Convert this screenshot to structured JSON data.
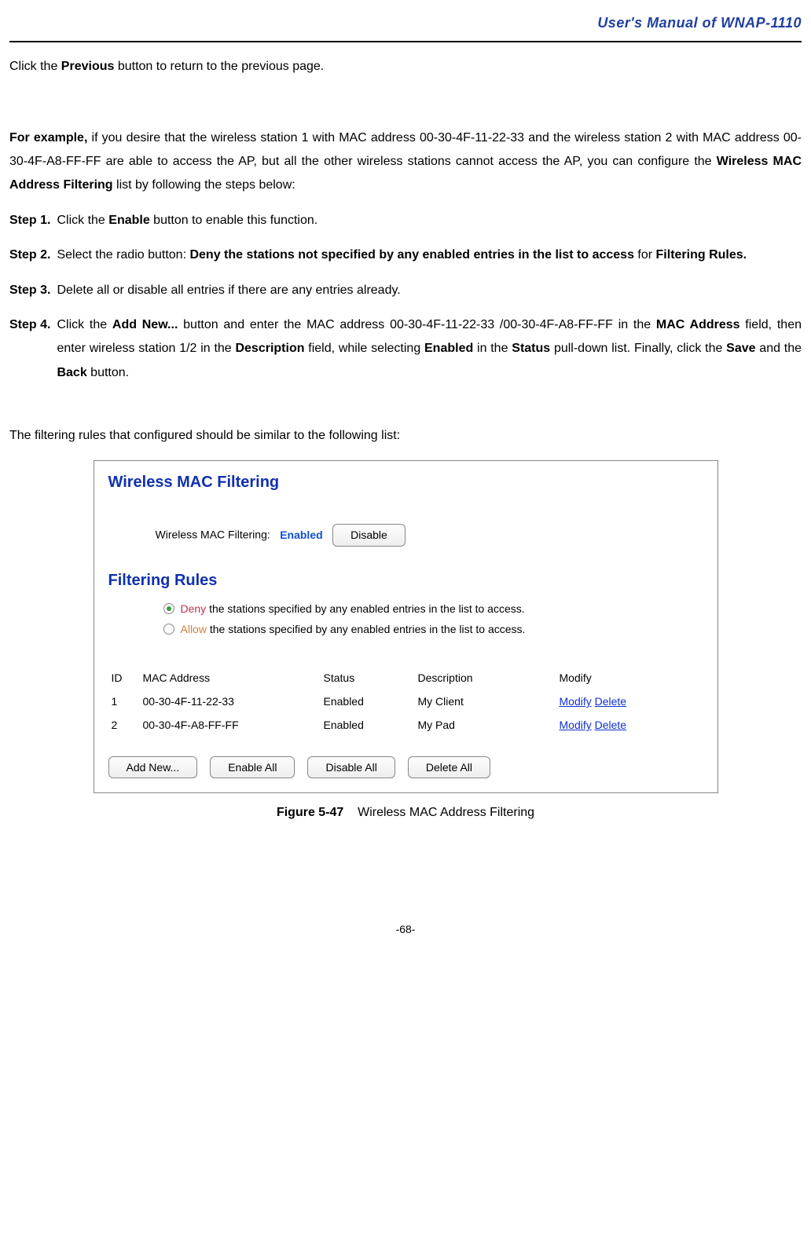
{
  "header": {
    "title": "User's  Manual  of  WNAP-1110"
  },
  "topline": {
    "prefix": "Click the ",
    "bold": "Previous",
    "suffix": " button to return to the previous page."
  },
  "intro": {
    "lead_bold": "For example,",
    "lead_rest": " if you desire that the wireless station 1 with MAC address 00-30-4F-11-22-33 and the wireless station 2 with MAC address 00-30-4F-A8-FF-FF are able to access the AP, but all the other wireless stations cannot access the AP, you can configure the ",
    "mid_bold": "Wireless MAC Address Filtering",
    "lead_tail": " list by following the steps below:"
  },
  "steps": {
    "s1": {
      "label": "Step 1.",
      "a": "Click the ",
      "b1": "Enable",
      "c": " button to enable this function."
    },
    "s2": {
      "label": "Step 2.",
      "a": "Select the radio button: ",
      "b1": "Deny the stations not specified by any enabled entries in the list to access",
      "c": " for ",
      "b2": "Filtering Rules."
    },
    "s3": {
      "label": "Step 3.",
      "a": "Delete all or disable all entries if there are any entries already."
    },
    "s4": {
      "label": "Step 4.",
      "a": "Click the ",
      "b1": "Add New...",
      "c": " button and enter the MAC address 00-30-4F-11-22-33 /00-30-4F-A8-FF-FF in the ",
      "b2": "MAC Address",
      "d": " field, then enter wireless station 1/2 in the ",
      "b3": "Description",
      "e": " field, while selecting ",
      "b4": "Enabled",
      "f": " in the ",
      "b5": "Status",
      "g": " pull-down list. Finally, click the ",
      "b6": "Save",
      "h": " and the ",
      "b7": "Back",
      "i": " button."
    }
  },
  "result_intro": "The filtering rules that configured should be similar to the following list:",
  "figure": {
    "title": "Wireless MAC Filtering",
    "filter_label": "Wireless MAC Filtering:",
    "status": "Enabled",
    "disable_btn": "Disable",
    "rules_title": "Filtering Rules",
    "deny_word": "Deny",
    "deny_rest": " the stations specified by any enabled entries in the list to access.",
    "allow_word": "Allow",
    "allow_rest": " the stations specified by any enabled entries in the list to access.",
    "cols": {
      "id": "ID",
      "mac": "MAC Address",
      "status": "Status",
      "desc": "Description",
      "modify": "Modify"
    },
    "rows": [
      {
        "id": "1",
        "mac": "00-30-4F-11-22-33",
        "status": "Enabled",
        "desc": "My Client",
        "m": "Modify",
        "d": "Delete"
      },
      {
        "id": "2",
        "mac": "00-30-4F-A8-FF-FF",
        "status": "Enabled",
        "desc": "My Pad",
        "m": "Modify",
        "d": "Delete"
      }
    ],
    "btns": {
      "add": "Add New...",
      "enable": "Enable All",
      "disable": "Disable All",
      "delete": "Delete All"
    }
  },
  "caption": {
    "bold": "Figure 5-47",
    "rest": "    Wireless MAC Address Filtering"
  },
  "page_number": "-68-"
}
